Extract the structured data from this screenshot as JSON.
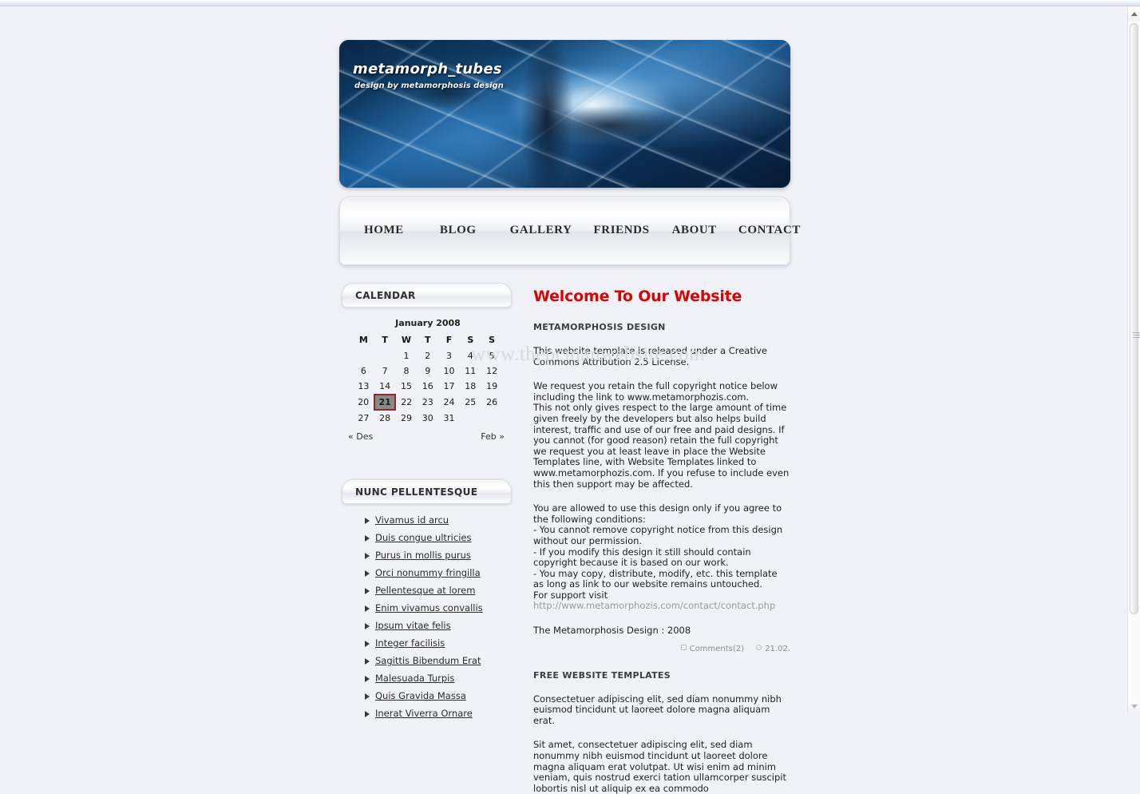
{
  "site": {
    "title": "metamorph_tubes",
    "tagline": "design by metamorphosis design"
  },
  "nav": {
    "items": [
      {
        "label": "HOME"
      },
      {
        "label": "BLOG"
      },
      {
        "label": "GALLERY"
      },
      {
        "label": "FRIENDS"
      },
      {
        "label": "ABOUT"
      },
      {
        "label": "CONTACT"
      }
    ]
  },
  "sidebar": {
    "calendar": {
      "title": "CALENDAR",
      "caption": "January 2008",
      "weekdays": [
        "M",
        "T",
        "W",
        "T",
        "F",
        "S",
        "S"
      ],
      "weeks": [
        [
          "",
          "",
          "1",
          "2",
          "3",
          "4",
          "5"
        ],
        [
          "6",
          "7",
          "8",
          "9",
          "10",
          "11",
          "12"
        ],
        [
          "13",
          "14",
          "15",
          "16",
          "17",
          "18",
          "19"
        ],
        [
          "20",
          "21",
          "22",
          "23",
          "24",
          "25",
          "26"
        ],
        [
          "27",
          "28",
          "29",
          "30",
          "31",
          "",
          ""
        ]
      ],
      "today": "21",
      "prev_label": "« Des",
      "next_label": "Feb »",
      "today_bg": "#8a8a8a",
      "today_border": "#8d2b2b"
    },
    "links_widget": {
      "title": "NUNC PELLENTESQUE",
      "items": [
        {
          "label": "Vivamus id arcu"
        },
        {
          "label": "Duis congue ultricies"
        },
        {
          "label": "Purus in mollis purus"
        },
        {
          "label": "Orci nonummy fringilla"
        },
        {
          "label": "Pellentesque at lorem"
        },
        {
          "label": "Enim vivamus convallis"
        },
        {
          "label": "Ipsum vitae felis"
        },
        {
          "label": "Integer facilisis"
        },
        {
          "label": "Sagittis Bibendum Erat"
        },
        {
          "label": "Malesuada Turpis"
        },
        {
          "label": "Quis Gravida Massa"
        },
        {
          "label": "Inerat Viverra Ornare"
        }
      ]
    }
  },
  "content": {
    "heading": "Welcome To Our Website",
    "post1": {
      "subheading": "METAMORPHOSIS DESIGN",
      "p1": "This website template is released under a Creative Commons Attribution 2.5 License.",
      "p2": "We request you retain the full copyright notice below including the link to www.metamorphozis.com.",
      "p3": "This not only gives respect to the large amount of time given freely by the developers but also helps build interest, traffic and use of our free and paid designs. If you cannot (for good reason) retain the full copyright we request you at least leave in place the Website Templates line, with Website Templates linked to www.metamorphozis.com. If you refuse to include even this then support may be affected.",
      "p4": "You are allowed to use this design only if you agree to the following conditions:",
      "p5": "- You cannot remove copyright notice from this design without our permission.",
      "p6": "- If you modify this design it still should contain copyright because it is based on our work.",
      "p7": "- You may copy, distribute, modify, etc. this template as long as link to our website remains untouched.",
      "support_prefix": "For support visit ",
      "support_link": "http://www.metamorphozis.com/contact/contact.php",
      "p8": "The Metamorphosis Design : 2008",
      "meta": {
        "comments": "Comments(2)",
        "date": "21.02."
      }
    },
    "post2": {
      "subheading": "FREE WEBSITE TEMPLATES",
      "p1": "Consectetuer adipiscing elit, sed diam nonummy nibh euismod tincidunt ut laoreet dolore magna aliquam erat.",
      "p2": "Sit amet, consectetuer adipiscing elit, sed diam nonummy nibh euismod tincidunt ut laoreet dolore magna aliquam erat volutpat. Ut wisi enim ad minim veniam, quis nostrud exerci tation ullamcorper suscipit lobortis nisl ut aliquip ex ea commodo"
    }
  },
  "watermark": {
    "text": "www.thepcmanwebsite.com"
  }
}
